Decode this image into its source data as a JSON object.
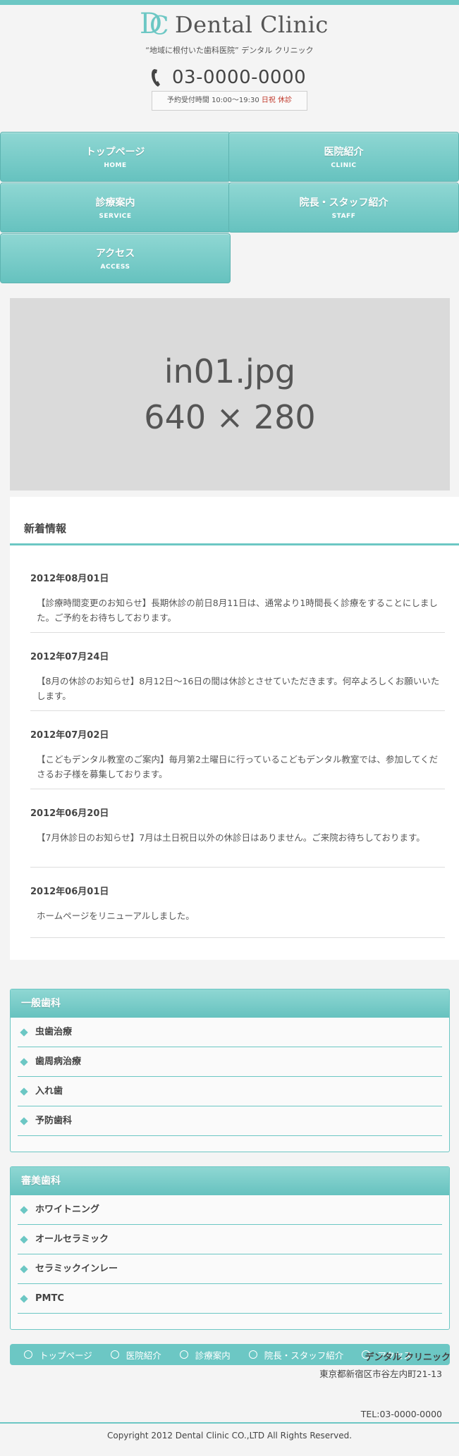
{
  "header": {
    "logo_text": "Dental Clinic",
    "logo_mark_d": "D",
    "logo_mark_c": "C",
    "tagline": "“地域に根付いた歯科医院” デンタル クリニック",
    "phone": "03-0000-0000",
    "hours_label": "予約受付時間 10:00〜19:30",
    "holiday": "日祝 休診"
  },
  "nav": [
    {
      "jp": "トップページ",
      "en": "HOME"
    },
    {
      "jp": "医院紹介",
      "en": "CLINIC"
    },
    {
      "jp": "診療案内",
      "en": "SERVICE"
    },
    {
      "jp": "院長・スタッフ紹介",
      "en": "STAFF"
    },
    {
      "jp": "アクセス",
      "en": "ACCESS"
    }
  ],
  "hero": {
    "line1": "in01.jpg",
    "line2": "640 × 280"
  },
  "news": {
    "title": "新着情報",
    "items": [
      {
        "date": "2012年08月01日",
        "text": "【診療時間変更のお知らせ】長期休診の前日8月11日は、通常より1時間長く診療をすることにしました。ご予約をお待ちしております。"
      },
      {
        "date": "2012年07月24日",
        "text": "【8月の休診のお知らせ】8月12日〜16日の間は休診とさせていただきます。何卒よろしくお願いいたします。"
      },
      {
        "date": "2012年07月02日",
        "text": "【こどもデンタル教室のご案内】毎月第2土曜日に行っているこどもデンタル教室では、参加してくださるお子様を募集しております。"
      },
      {
        "date": "2012年06月20日",
        "text": "【7月休診日のお知らせ】7月は土日祝日以外の休診日はありません。ご来院お待ちしております。"
      },
      {
        "date": "2012年06月01日",
        "text": "ホームページをリニューアルしました。"
      }
    ]
  },
  "general": {
    "title": "一般歯科",
    "items": [
      "虫歯治療",
      "歯周病治療",
      "入れ歯",
      "予防歯科"
    ]
  },
  "cosmetic": {
    "title": "審美歯科",
    "items": [
      "ホワイトニング",
      "オールセラミック",
      "セラミックインレー",
      "PMTC"
    ]
  },
  "footer_nav": [
    "トップページ",
    "医院紹介",
    "診療案内",
    "院長・スタッフ紹介",
    "アクセス"
  ],
  "footer": {
    "name": "デンタル クリニック",
    "address": "東京都新宿区市谷左内町21-13",
    "tel": "TEL:03-0000-0000",
    "copyright": "Copyright 2012 Dental Clinic CO.,LTD All Rights Reserved."
  },
  "colors": {
    "accent": "#6cc7c4",
    "holiday": "#c0392b",
    "hero_bg": "#dadada"
  }
}
